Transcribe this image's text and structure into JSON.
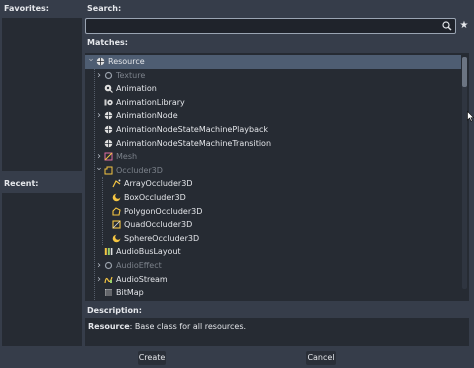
{
  "favorites": {
    "label": "Favorites:"
  },
  "recent": {
    "label": "Recent:"
  },
  "search": {
    "label": "Search:",
    "value": "",
    "placeholder": ""
  },
  "matches": {
    "label": "Matches:",
    "items": [
      {
        "label": "Resource",
        "icon": "resource-icon",
        "arrow": "v",
        "dim": false
      },
      {
        "label": "Texture",
        "icon": "circle-icon",
        "arrow": ">",
        "dim": true
      },
      {
        "label": "Animation",
        "icon": "animation-icon",
        "arrow": "",
        "dim": false
      },
      {
        "label": "AnimationLibrary",
        "icon": "animation-library-icon",
        "arrow": "",
        "dim": false
      },
      {
        "label": "AnimationNode",
        "icon": "resource-icon",
        "arrow": ">",
        "dim": false
      },
      {
        "label": "AnimationNodeStateMachinePlayback",
        "icon": "resource-icon",
        "arrow": "",
        "dim": false
      },
      {
        "label": "AnimationNodeStateMachineTransition",
        "icon": "resource-icon",
        "arrow": "",
        "dim": false
      },
      {
        "label": "Mesh",
        "icon": "mesh-icon",
        "arrow": ">",
        "dim": true
      },
      {
        "label": "Occluder3D",
        "icon": "occluder-icon",
        "arrow": "v",
        "dim": true
      },
      {
        "label": "ArrayOccluder3D",
        "icon": "array-occluder-icon",
        "arrow": "",
        "dim": false
      },
      {
        "label": "BoxOccluder3D",
        "icon": "moon-icon",
        "arrow": "",
        "dim": false
      },
      {
        "label": "PolygonOccluder3D",
        "icon": "polygon-occluder-icon",
        "arrow": "",
        "dim": false
      },
      {
        "label": "QuadOccluder3D",
        "icon": "quad-occluder-icon",
        "arrow": "",
        "dim": false
      },
      {
        "label": "SphereOccluder3D",
        "icon": "moon-icon",
        "arrow": "",
        "dim": false
      },
      {
        "label": "AudioBusLayout",
        "icon": "audio-bus-icon",
        "arrow": "",
        "dim": false
      },
      {
        "label": "AudioEffect",
        "icon": "circle-icon",
        "arrow": ">",
        "dim": true
      },
      {
        "label": "AudioStream",
        "icon": "audio-stream-icon",
        "arrow": ">",
        "dim": false
      },
      {
        "label": "BitMap",
        "icon": "bitmap-icon",
        "arrow": "",
        "dim": false
      }
    ]
  },
  "description": {
    "label": "Description:",
    "class_name": "Resource",
    "text": ": Base class for all resources."
  },
  "buttons": {
    "create": "Create",
    "cancel": "Cancel"
  },
  "colors": {
    "background": "#363d4a",
    "panel": "#262b33",
    "selection": "#4e5d72",
    "occluder_accent": "#f5c542",
    "anim_accent": "#e0e0e0"
  }
}
